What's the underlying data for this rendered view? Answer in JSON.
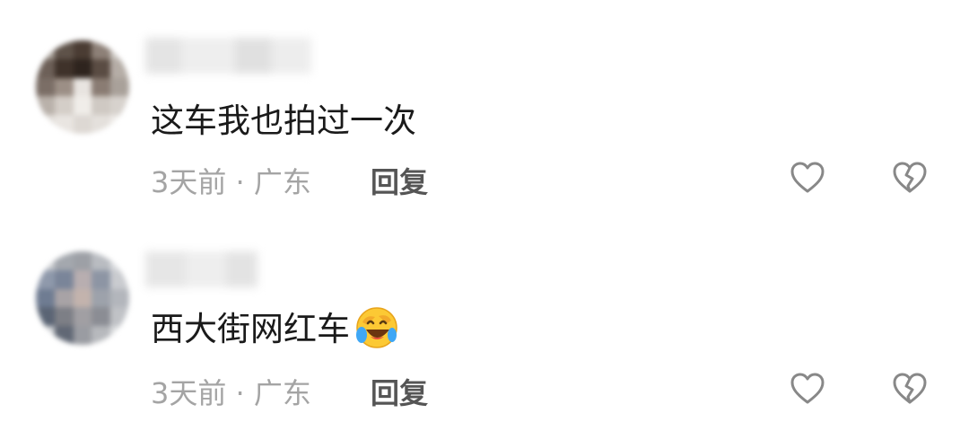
{
  "comments": [
    {
      "text": "这车我也拍过一次",
      "time": "3天前",
      "separator": "·",
      "location": "广东",
      "reply_label": "回复",
      "has_emoji": false
    },
    {
      "text": "西大街网红车",
      "time": "3天前",
      "separator": "·",
      "location": "广东",
      "reply_label": "回复",
      "has_emoji": true,
      "emoji_icon": "laughing-crying-emoji"
    }
  ],
  "colors": {
    "text": "#1a1a1a",
    "meta": "#a4a4a4",
    "reply": "#555555",
    "icon_stroke": "#888888"
  }
}
